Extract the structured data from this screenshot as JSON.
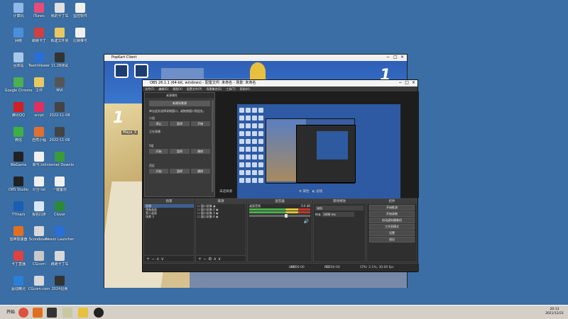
{
  "desktop": {
    "icons": [
      {
        "label": "计算机",
        "color": "#8fb8e8"
      },
      {
        "label": "iTunes",
        "color": "#e84b7a"
      },
      {
        "label": "我的卡丁车",
        "color": "#e0e0e0"
      },
      {
        "label": "监控软件",
        "color": "#f0f0f0"
      },
      {
        "label": "网络",
        "color": "#4a8fd8"
      },
      {
        "label": "跑跑卡丁",
        "color": "#d04040"
      },
      {
        "label": "新建文件夹",
        "color": "#e8c860"
      },
      {
        "label": "比赛推号",
        "color": "#f0f0f0"
      },
      {
        "label": "回收站",
        "color": "#a8c8e8"
      },
      {
        "label": "TeamViewer",
        "color": "#2a6fd8"
      },
      {
        "label": "11.28测试",
        "color": "#333333"
      },
      {
        "label": "Google Chrome",
        "color": "#4caf50"
      },
      {
        "label": "工作",
        "color": "#e8c860"
      },
      {
        "label": "MVI",
        "color": "#555555"
      },
      {
        "label": "腾讯QQ",
        "color": "#d02020"
      },
      {
        "label": "sccpt",
        "color": "#e03060"
      },
      {
        "label": "2022-11-08",
        "color": "#444444"
      },
      {
        "label": "微信",
        "color": "#3cb043"
      },
      {
        "label": "自然小程",
        "color": "#e07030"
      },
      {
        "label": "2022-11-06",
        "color": "#444444"
      },
      {
        "label": "WeGame",
        "color": "#222222"
      },
      {
        "label": "账号.txt",
        "color": "#f0f0f0"
      },
      {
        "label": "Internet Downlo",
        "color": "#3a9a3a"
      },
      {
        "label": "OBS Studio",
        "color": "#222222"
      },
      {
        "label": "计分.txt",
        "color": "#f0f0f0"
      },
      {
        "label": "一键备份",
        "color": "#f0f0f0"
      },
      {
        "label": "YYmars",
        "color": "#1a5fb4"
      },
      {
        "label": "报名同步",
        "color": "#d8e8f8"
      },
      {
        "label": "Clover",
        "color": "#2a8a3a"
      },
      {
        "label": "雷神加速器",
        "color": "#e07020"
      },
      {
        "label": "Scoreboard",
        "color": "#d8d8d8"
      },
      {
        "label": "Nexon Launcher",
        "color": "#2a6fd8"
      },
      {
        "label": "卡丁直播",
        "color": "#e04040"
      },
      {
        "label": "CGcom",
        "color": "#c8c8c8"
      },
      {
        "label": "跑跑卡丁车",
        "color": "#d8d8d8"
      },
      {
        "label": "驱动精灵",
        "color": "#2a7fd8"
      },
      {
        "label": "CGcom.com",
        "color": "#d8d8d8"
      },
      {
        "label": "2024比赛",
        "color": "#333333"
      }
    ]
  },
  "game_window": {
    "title": "PopKart Client",
    "hud_number": "1",
    "hud_number_right": "1",
    "player_tag": "Maya_X"
  },
  "obs": {
    "title": "OBS 26.1.1 (64-bit, windows) - 配置文件: 未命名 - 场景: 未命名",
    "menu": [
      "文件(F)",
      "编辑(E)",
      "视图(V)",
      "配置文件(P)",
      "场景集合(S)",
      "工具(T)",
      "帮助(H)"
    ],
    "dialog": {
      "title": "来源属性",
      "header": "新建场景源",
      "desc": "单击此处选择录制窗口，或拖拽窗口到此处。",
      "section1": "小组",
      "section1_buttons": [
        "停止",
        "暂停",
        "开始"
      ],
      "section2": "正在直播",
      "section3": "5组",
      "section3_buttons": [
        "开始",
        "暂停",
        "删除"
      ],
      "section4": "西区",
      "section4_buttons": [
        "开始",
        "暂停",
        "删除"
      ]
    },
    "preview_status_left": "未选择源",
    "preview_status_mid": "属性",
    "preview_status_right": "滤镜",
    "scenes_header": "场景",
    "scenes": [
      "直播",
      "预备画面",
      "第二画面",
      "场景 3"
    ],
    "sources_header": "来源",
    "sources": [
      "窗口采集",
      "窗口采集 2",
      "窗口采集 3",
      "窗口采集 4"
    ],
    "mixer_header": "混音器",
    "mixer_track": "桌面音频",
    "mixer_db": "0.0 dB",
    "transitions_header": "转场特效",
    "transition_value": "淡出",
    "duration_label": "时长",
    "duration_value": "1000 ms",
    "controls_header": "控件",
    "controls": [
      "开始推流",
      "开始录制",
      "启动虚拟摄像机",
      "工作室模式",
      "设置",
      "退出"
    ],
    "status": {
      "live_label": "LIVE",
      "live_time": "00:00:00",
      "rec_label": "REC",
      "rec_time": "00:00:00",
      "cpu": "CPU: 2.1%, 30.00 fps"
    }
  },
  "taskbar": {
    "start_label": "开始",
    "time": "20:13",
    "date": "2021/12/21"
  }
}
